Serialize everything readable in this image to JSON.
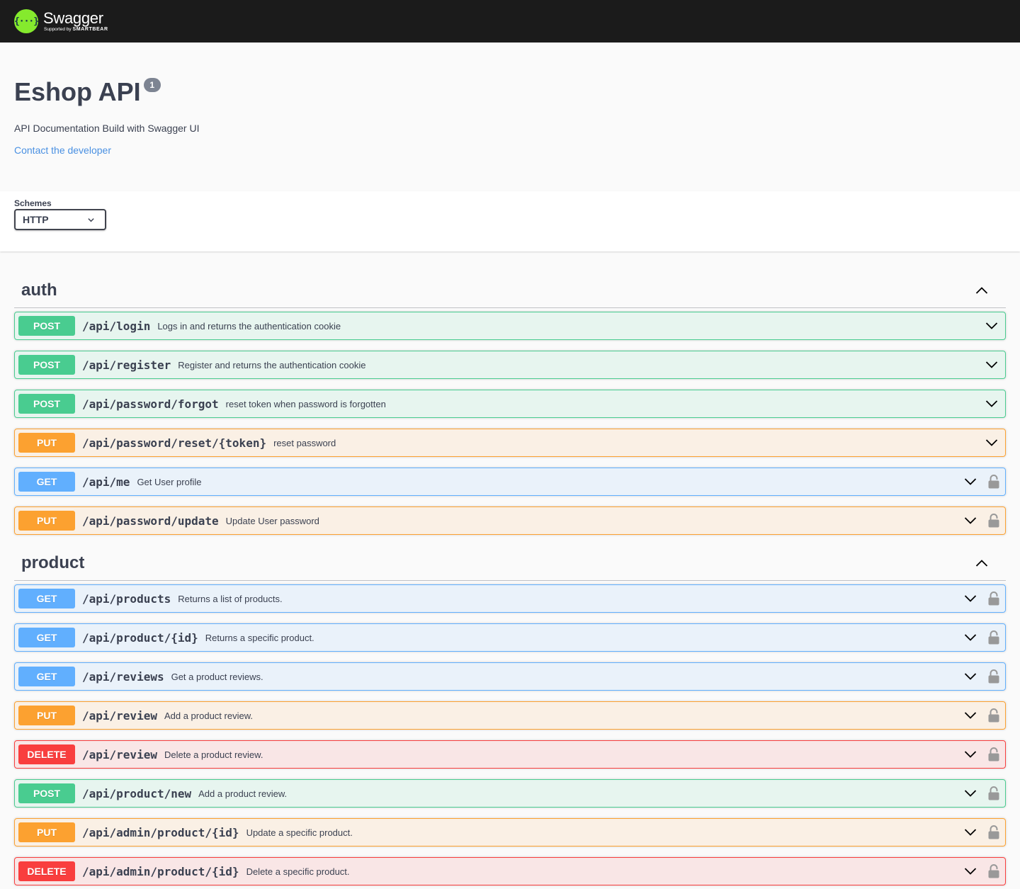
{
  "topbar": {
    "logo_mark": "{···}",
    "logo_name": "Swagger",
    "logo_supported_by": "Supported by",
    "logo_company": "SMARTBEAR"
  },
  "info": {
    "title": "Eshop API",
    "version": "1",
    "description": "API Documentation Build with Swagger UI",
    "contact": "Contact the developer"
  },
  "schemes": {
    "label": "Schemes",
    "selected": "HTTP"
  },
  "tags": [
    {
      "name": "auth",
      "operations": [
        {
          "method": "POST",
          "path": "/api/login",
          "summary": "Logs in and returns the authentication cookie",
          "locked": false
        },
        {
          "method": "POST",
          "path": "/api/register",
          "summary": "Register and returns the authentication cookie",
          "locked": false
        },
        {
          "method": "POST",
          "path": "/api/password/forgot",
          "summary": "reset token when password is forgotten",
          "locked": false
        },
        {
          "method": "PUT",
          "path": "/api/password/reset/{token}",
          "summary": "reset password",
          "locked": false
        },
        {
          "method": "GET",
          "path": "/api/me",
          "summary": "Get User profile",
          "locked": true
        },
        {
          "method": "PUT",
          "path": "/api/password/update",
          "summary": "Update User password",
          "locked": true
        }
      ]
    },
    {
      "name": "product",
      "operations": [
        {
          "method": "GET",
          "path": "/api/products",
          "summary": "Returns a list of products.",
          "locked": true
        },
        {
          "method": "GET",
          "path": "/api/product/{id}",
          "summary": "Returns a specific product.",
          "locked": true
        },
        {
          "method": "GET",
          "path": "/api/reviews",
          "summary": "Get a product reviews.",
          "locked": true
        },
        {
          "method": "PUT",
          "path": "/api/review",
          "summary": "Add a product review.",
          "locked": true
        },
        {
          "method": "DELETE",
          "path": "/api/review",
          "summary": "Delete a product review.",
          "locked": true
        },
        {
          "method": "POST",
          "path": "/api/product/new",
          "summary": "Add a product review.",
          "locked": true
        },
        {
          "method": "PUT",
          "path": "/api/admin/product/{id}",
          "summary": "Update a specific product.",
          "locked": true
        },
        {
          "method": "DELETE",
          "path": "/api/admin/product/{id}",
          "summary": "Delete a specific product.",
          "locked": true
        }
      ]
    }
  ],
  "colors": {
    "post": "#49cc90",
    "put": "#fca130",
    "get": "#61affe",
    "delete": "#f93e3e",
    "topbar": "#1b1b1b",
    "logo": "#85ea2d",
    "link": "#4990e2"
  },
  "icons": {
    "select": "chevron-down-icon",
    "tag_toggle": "chevron-up-icon",
    "operation_toggle": "chevron-down-icon",
    "auth": "unlock-icon"
  }
}
